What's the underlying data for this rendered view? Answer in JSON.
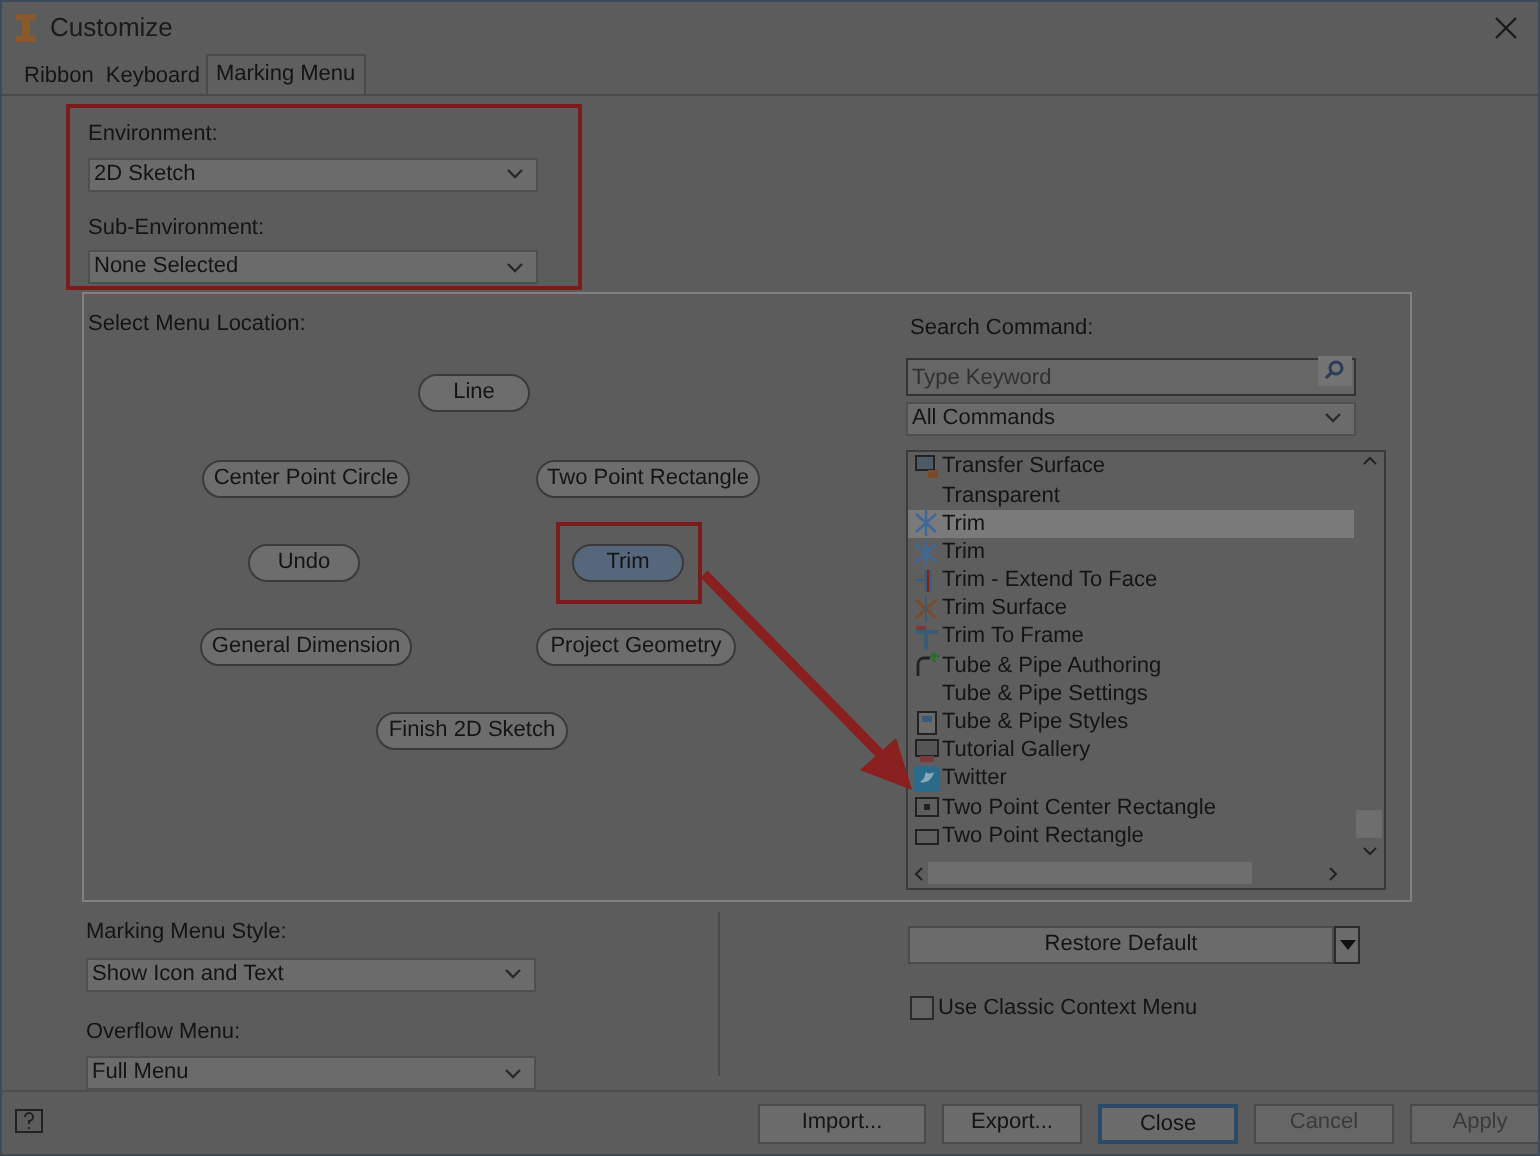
{
  "window": {
    "title": "Customize"
  },
  "tabs": [
    {
      "label": "Ribbon",
      "selected": false
    },
    {
      "label": "Keyboard",
      "selected": false
    },
    {
      "label": "Marking Menu",
      "selected": true
    }
  ],
  "environment": {
    "label": "Environment:",
    "value": "2D Sketch"
  },
  "sub_environment": {
    "label": "Sub-Environment:",
    "value": "None Selected"
  },
  "menu_location": {
    "label": "Select Menu Location:",
    "slots": [
      {
        "label": "Line",
        "selected": false
      },
      {
        "label": "Center Point Circle",
        "selected": false
      },
      {
        "label": "Two Point Rectangle",
        "selected": false
      },
      {
        "label": "Undo",
        "selected": false
      },
      {
        "label": "Trim",
        "selected": true
      },
      {
        "label": "General Dimension",
        "selected": false
      },
      {
        "label": "Project Geometry",
        "selected": false
      },
      {
        "label": "Finish 2D Sketch",
        "selected": false
      }
    ]
  },
  "search": {
    "label": "Search Command:",
    "placeholder": "Type Keyword"
  },
  "filter": {
    "value": "All Commands"
  },
  "commands": [
    {
      "label": "Transfer Surface",
      "kind": "surface",
      "selected": false
    },
    {
      "label": "Transparent",
      "kind": "none",
      "selected": false
    },
    {
      "label": "Trim",
      "kind": "trim",
      "selected": true
    },
    {
      "label": "Trim",
      "kind": "trim",
      "selected": false
    },
    {
      "label": "Trim - Extend To Face",
      "kind": "extend",
      "selected": false
    },
    {
      "label": "Trim Surface",
      "kind": "trimsurface",
      "selected": false
    },
    {
      "label": "Trim To Frame",
      "kind": "frame",
      "selected": false
    },
    {
      "label": "Tube & Pipe Authoring",
      "kind": "tube",
      "selected": false
    },
    {
      "label": "Tube & Pipe Settings",
      "kind": "none",
      "selected": false
    },
    {
      "label": "Tube & Pipe Styles",
      "kind": "styles",
      "selected": false
    },
    {
      "label": "Tutorial Gallery",
      "kind": "gallery",
      "selected": false
    },
    {
      "label": "Twitter",
      "kind": "bird",
      "selected": false
    },
    {
      "label": "Two Point Center Rectangle",
      "kind": "centerrect",
      "selected": false
    },
    {
      "label": "Two Point Rectangle",
      "kind": "rect",
      "selected": false
    }
  ],
  "marking_menu_style": {
    "label": "Marking Menu Style:",
    "value": "Show Icon and Text"
  },
  "overflow_menu": {
    "label": "Overflow Menu:",
    "value": "Full Menu"
  },
  "restore_default": "Restore Default",
  "classic_context_menu": {
    "label": "Use Classic Context Menu",
    "checked": false
  },
  "footer_buttons": [
    {
      "label": "Import...",
      "kind": "normal",
      "disabled": false
    },
    {
      "label": "Export...",
      "kind": "normal",
      "disabled": false
    },
    {
      "label": "Close",
      "kind": "default",
      "disabled": false
    },
    {
      "label": "Cancel",
      "kind": "normal",
      "disabled": true
    },
    {
      "label": "Apply",
      "kind": "normal",
      "disabled": true
    }
  ]
}
